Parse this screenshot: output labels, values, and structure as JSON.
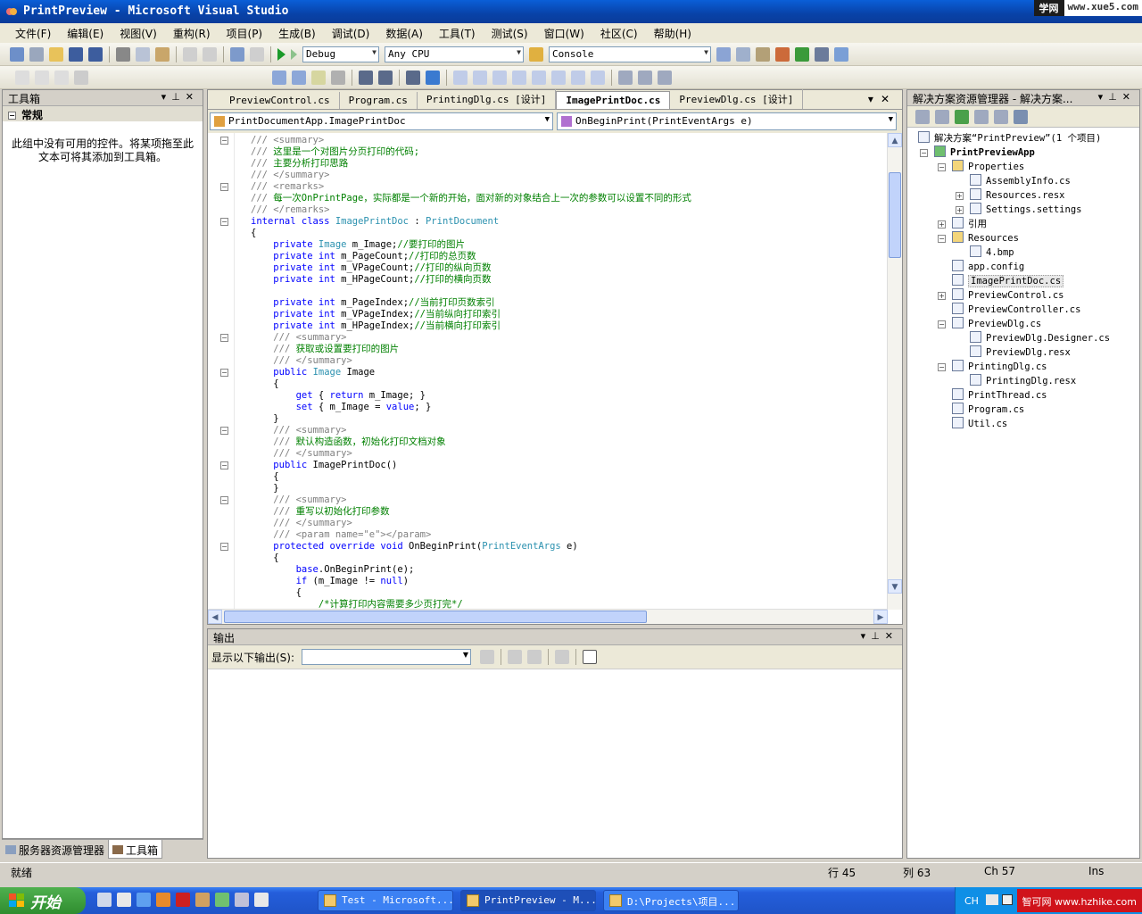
{
  "window": {
    "title": "PrintPreview - Microsoft Visual Studio"
  },
  "watermark_top": {
    "badge": "学网",
    "url": "www.xue5.com"
  },
  "menu": [
    "文件(F)",
    "编辑(E)",
    "视图(V)",
    "重构(R)",
    "项目(P)",
    "生成(B)",
    "调试(D)",
    "数据(A)",
    "工具(T)",
    "测试(S)",
    "窗口(W)",
    "社区(C)",
    "帮助(H)"
  ],
  "toolbar": {
    "config": "Debug",
    "platform": "Any CPU",
    "startup": "Console"
  },
  "toolbox": {
    "title": "工具箱",
    "group": "常规",
    "empty_message": "此组中没有可用的控件。将某项拖至此文本可将其添加到工具箱。",
    "tabs": [
      "服务器资源管理器",
      "工具箱"
    ]
  },
  "editor": {
    "tabs": [
      {
        "label": "PreviewControl.cs",
        "active": false
      },
      {
        "label": "Program.cs",
        "active": false
      },
      {
        "label": "PrintingDlg.cs [设计]",
        "active": false
      },
      {
        "label": "ImagePrintDoc.cs",
        "active": true
      },
      {
        "label": "PreviewDlg.cs [设计]",
        "active": false
      }
    ],
    "type_combo": "PrintDocumentApp.ImagePrintDoc",
    "member_combo": "OnBeginPrint(PrintEventArgs e)",
    "lines": [
      {
        "fold": "-",
        "parts": [
          [
            "doc",
            "/// <summary>"
          ]
        ]
      },
      {
        "parts": [
          [
            "doc",
            "/// "
          ],
          [
            "cmt",
            "这里是一个对图片分页打印的代码;"
          ]
        ]
      },
      {
        "parts": [
          [
            "doc",
            "/// "
          ],
          [
            "cmt",
            "主要分析打印思路"
          ]
        ]
      },
      {
        "parts": [
          [
            "doc",
            "/// </summary>"
          ]
        ]
      },
      {
        "fold": "-",
        "parts": [
          [
            "doc",
            "/// <remarks>"
          ]
        ]
      },
      {
        "parts": [
          [
            "doc",
            "/// "
          ],
          [
            "cmt",
            "每一次OnPrintPage，实际都是一个新的开始，面对新的对象结合上一次的参数可以设置不同的形式"
          ]
        ]
      },
      {
        "parts": [
          [
            "doc",
            "/// </remarks>"
          ]
        ]
      },
      {
        "fold": "-",
        "parts": [
          [
            "kw",
            "internal class "
          ],
          [
            "type",
            "ImagePrintDoc"
          ],
          [
            "txt",
            " : "
          ],
          [
            "type",
            "PrintDocument"
          ]
        ]
      },
      {
        "parts": [
          [
            "txt",
            "{"
          ]
        ]
      },
      {
        "parts": [
          [
            "txt",
            "    "
          ],
          [
            "kw",
            "private "
          ],
          [
            "type",
            "Image"
          ],
          [
            "txt",
            " m_Image;"
          ],
          [
            "cmt",
            "//要打印的图片"
          ]
        ]
      },
      {
        "parts": [
          [
            "txt",
            "    "
          ],
          [
            "kw",
            "private int"
          ],
          [
            "txt",
            " m_PageCount;"
          ],
          [
            "cmt",
            "//打印的总页数"
          ]
        ]
      },
      {
        "parts": [
          [
            "txt",
            "    "
          ],
          [
            "kw",
            "private int"
          ],
          [
            "txt",
            " m_VPageCount;"
          ],
          [
            "cmt",
            "//打印的纵向页数"
          ]
        ]
      },
      {
        "parts": [
          [
            "txt",
            "    "
          ],
          [
            "kw",
            "private int"
          ],
          [
            "txt",
            " m_HPageCount;"
          ],
          [
            "cmt",
            "//打印的横向页数"
          ]
        ]
      },
      {
        "parts": [
          [
            "txt",
            ""
          ]
        ]
      },
      {
        "parts": [
          [
            "txt",
            "    "
          ],
          [
            "kw",
            "private int"
          ],
          [
            "txt",
            " m_PageIndex;"
          ],
          [
            "cmt",
            "//当前打印页数索引"
          ]
        ]
      },
      {
        "parts": [
          [
            "txt",
            "    "
          ],
          [
            "kw",
            "private int"
          ],
          [
            "txt",
            " m_VPageIndex;"
          ],
          [
            "cmt",
            "//当前纵向打印索引"
          ]
        ]
      },
      {
        "parts": [
          [
            "txt",
            "    "
          ],
          [
            "kw",
            "private int"
          ],
          [
            "txt",
            " m_HPageIndex;"
          ],
          [
            "cmt",
            "//当前横向打印索引"
          ]
        ]
      },
      {
        "fold": "-",
        "parts": [
          [
            "txt",
            "    "
          ],
          [
            "doc",
            "/// <summary>"
          ]
        ]
      },
      {
        "parts": [
          [
            "txt",
            "    "
          ],
          [
            "doc",
            "/// "
          ],
          [
            "cmt",
            "获取或设置要打印的图片"
          ]
        ]
      },
      {
        "parts": [
          [
            "txt",
            "    "
          ],
          [
            "doc",
            "/// </summary>"
          ]
        ]
      },
      {
        "fold": "-",
        "parts": [
          [
            "txt",
            "    "
          ],
          [
            "kw",
            "public "
          ],
          [
            "type",
            "Image"
          ],
          [
            "txt",
            " Image"
          ]
        ]
      },
      {
        "parts": [
          [
            "txt",
            "    {"
          ]
        ]
      },
      {
        "parts": [
          [
            "txt",
            "        "
          ],
          [
            "kw",
            "get"
          ],
          [
            "txt",
            " { "
          ],
          [
            "kw",
            "return"
          ],
          [
            "txt",
            " m_Image; }"
          ]
        ]
      },
      {
        "parts": [
          [
            "txt",
            "        "
          ],
          [
            "kw",
            "set"
          ],
          [
            "txt",
            " { m_Image = "
          ],
          [
            "kw",
            "value"
          ],
          [
            "txt",
            "; }"
          ]
        ]
      },
      {
        "parts": [
          [
            "txt",
            "    }"
          ]
        ]
      },
      {
        "fold": "-",
        "parts": [
          [
            "txt",
            "    "
          ],
          [
            "doc",
            "/// <summary>"
          ]
        ]
      },
      {
        "parts": [
          [
            "txt",
            "    "
          ],
          [
            "doc",
            "/// "
          ],
          [
            "cmt",
            "默认构造函数，初始化打印文档对象"
          ]
        ]
      },
      {
        "parts": [
          [
            "txt",
            "    "
          ],
          [
            "doc",
            "/// </summary>"
          ]
        ]
      },
      {
        "fold": "-",
        "parts": [
          [
            "txt",
            "    "
          ],
          [
            "kw",
            "public"
          ],
          [
            "txt",
            " ImagePrintDoc()"
          ]
        ]
      },
      {
        "parts": [
          [
            "txt",
            "    {"
          ]
        ]
      },
      {
        "parts": [
          [
            "txt",
            "    }"
          ]
        ]
      },
      {
        "fold": "-",
        "parts": [
          [
            "txt",
            "    "
          ],
          [
            "doc",
            "/// <summary>"
          ]
        ]
      },
      {
        "parts": [
          [
            "txt",
            "    "
          ],
          [
            "doc",
            "/// "
          ],
          [
            "cmt",
            "重写以初始化打印参数"
          ]
        ]
      },
      {
        "parts": [
          [
            "txt",
            "    "
          ],
          [
            "doc",
            "/// </summary>"
          ]
        ]
      },
      {
        "parts": [
          [
            "txt",
            "    "
          ],
          [
            "doc",
            "/// <param name=\"e\"></param>"
          ]
        ]
      },
      {
        "fold": "-",
        "parts": [
          [
            "txt",
            "    "
          ],
          [
            "kw",
            "protected override void"
          ],
          [
            "txt",
            " OnBeginPrint("
          ],
          [
            "type",
            "PrintEventArgs"
          ],
          [
            "txt",
            " e)"
          ]
        ]
      },
      {
        "parts": [
          [
            "txt",
            "    {"
          ]
        ]
      },
      {
        "parts": [
          [
            "txt",
            "        "
          ],
          [
            "kw",
            "base"
          ],
          [
            "txt",
            ".OnBeginPrint(e);"
          ]
        ]
      },
      {
        "parts": [
          [
            "txt",
            "        "
          ],
          [
            "kw",
            "if"
          ],
          [
            "txt",
            " (m_Image != "
          ],
          [
            "kw",
            "null"
          ],
          [
            "txt",
            ")"
          ]
        ]
      },
      {
        "parts": [
          [
            "txt",
            "        {"
          ]
        ]
      },
      {
        "parts": [
          [
            "txt",
            "            "
          ],
          [
            "cmt",
            "/*计算打印内容需要多少页打完*/"
          ]
        ]
      }
    ]
  },
  "output": {
    "title": "输出",
    "show_label": "显示以下输出(S):",
    "selected": ""
  },
  "solution": {
    "title": "解决方案资源管理器 - 解决方案...",
    "nodes": [
      {
        "label": "解决方案“PrintPreview”(1 个项目)",
        "level": 0,
        "exp": "",
        "bold": false
      },
      {
        "label": "PrintPreviewApp",
        "level": 1,
        "exp": "-",
        "bold": true
      },
      {
        "label": "Properties",
        "level": 2,
        "exp": "-",
        "bold": false
      },
      {
        "label": "AssemblyInfo.cs",
        "level": 3,
        "exp": "",
        "bold": false
      },
      {
        "label": "Resources.resx",
        "level": 3,
        "exp": "+",
        "bold": false
      },
      {
        "label": "Settings.settings",
        "level": 3,
        "exp": "+",
        "bold": false
      },
      {
        "label": "引用",
        "level": 2,
        "exp": "+",
        "bold": false
      },
      {
        "label": "Resources",
        "level": 2,
        "exp": "-",
        "bold": false
      },
      {
        "label": "4.bmp",
        "level": 3,
        "exp": "",
        "bold": false
      },
      {
        "label": "app.config",
        "level": 2,
        "exp": "",
        "bold": false
      },
      {
        "label": "ImagePrintDoc.cs",
        "level": 2,
        "exp": "",
        "bold": false,
        "selected": true
      },
      {
        "label": "PreviewControl.cs",
        "level": 2,
        "exp": "+",
        "bold": false
      },
      {
        "label": "PreviewController.cs",
        "level": 2,
        "exp": "",
        "bold": false
      },
      {
        "label": "PreviewDlg.cs",
        "level": 2,
        "exp": "-",
        "bold": false
      },
      {
        "label": "PreviewDlg.Designer.cs",
        "level": 3,
        "exp": "",
        "bold": false
      },
      {
        "label": "PreviewDlg.resx",
        "level": 3,
        "exp": "",
        "bold": false
      },
      {
        "label": "PrintingDlg.cs",
        "level": 2,
        "exp": "-",
        "bold": false
      },
      {
        "label": "PrintingDlg.resx",
        "level": 3,
        "exp": "",
        "bold": false
      },
      {
        "label": "PrintThread.cs",
        "level": 2,
        "exp": "",
        "bold": false
      },
      {
        "label": "Program.cs",
        "level": 2,
        "exp": "",
        "bold": false
      },
      {
        "label": "Util.cs",
        "level": 2,
        "exp": "",
        "bold": false
      }
    ]
  },
  "status": {
    "text": "就绪",
    "line": "行 45",
    "col": "列 63",
    "ch": "Ch 57",
    "mode": "Ins"
  },
  "taskbar": {
    "start": "开始",
    "tasks": [
      {
        "label": "Test - Microsoft...",
        "active": false
      },
      {
        "label": "PrintPreview - M...",
        "active": true
      },
      {
        "label": "D:\\Projects\\项目...",
        "active": false
      }
    ],
    "tray_lang": "CH",
    "watermark": "智可网 www.hzhike.com"
  }
}
